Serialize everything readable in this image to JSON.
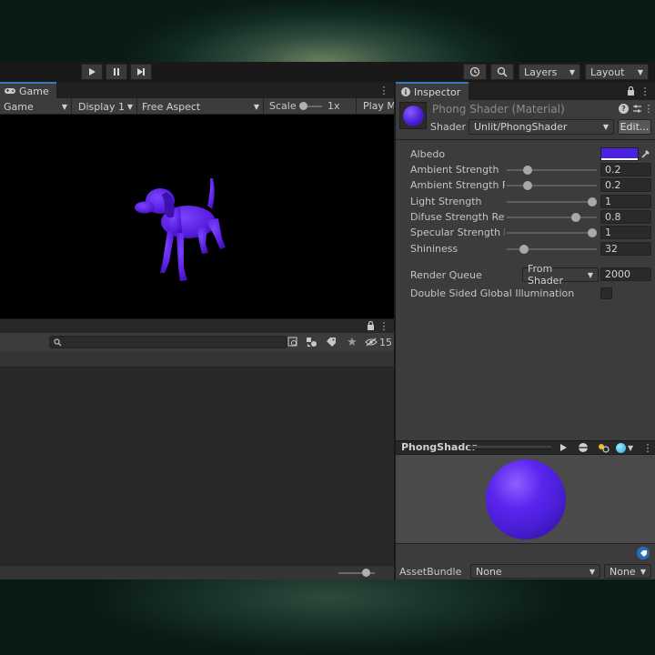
{
  "toolbar": {
    "play_icon": "play-icon",
    "pause_icon": "pause-icon",
    "step_icon": "step-icon",
    "history_icon": "history-icon",
    "search_icon": "search-icon",
    "layers_label": "Layers",
    "layout_label": "Layout"
  },
  "game": {
    "tab_label": "Game",
    "view_select": "Game",
    "display_select": "Display 1",
    "aspect_select": "Free Aspect",
    "scale_label": "Scale",
    "scale_value": "1x",
    "play_mode_label": "Play M",
    "model_color": "#5a1fe0"
  },
  "lower_panel": {
    "count_label": "15"
  },
  "inspector": {
    "tab_label": "Inspector",
    "title": "Phong Shader (Material)",
    "shader_label": "Shader",
    "shader_value": "Unlit/PhongShader",
    "edit_button": "Edit...",
    "albedo_label": "Albedo",
    "albedo_color": "#4b22e0",
    "properties": [
      {
        "label": "Ambient Strength",
        "value": "0.2",
        "fraction": 0.2
      },
      {
        "label": "Ambient Strength Ref",
        "value": "0.2",
        "fraction": 0.2
      },
      {
        "label": "Light Strength",
        "value": "1",
        "fraction": 1.0
      },
      {
        "label": "Difuse Strength Refle",
        "value": "0.8",
        "fraction": 0.8
      },
      {
        "label": "Specular Strength Re",
        "value": "1",
        "fraction": 1.0
      },
      {
        "label": "Shininess",
        "value": "32",
        "fraction": 0.16
      }
    ],
    "render_queue_label": "Render Queue",
    "render_queue_select": "From Shader",
    "render_queue_value": "2000",
    "dsgi_label": "Double Sided Global Illumination",
    "dsgi_checked": false
  },
  "preview": {
    "title": "PhongShader",
    "sphere_color": "#4a1fd6"
  },
  "asset_bundle": {
    "label": "AssetBundle",
    "name_select": "None",
    "variant_select": "None"
  }
}
